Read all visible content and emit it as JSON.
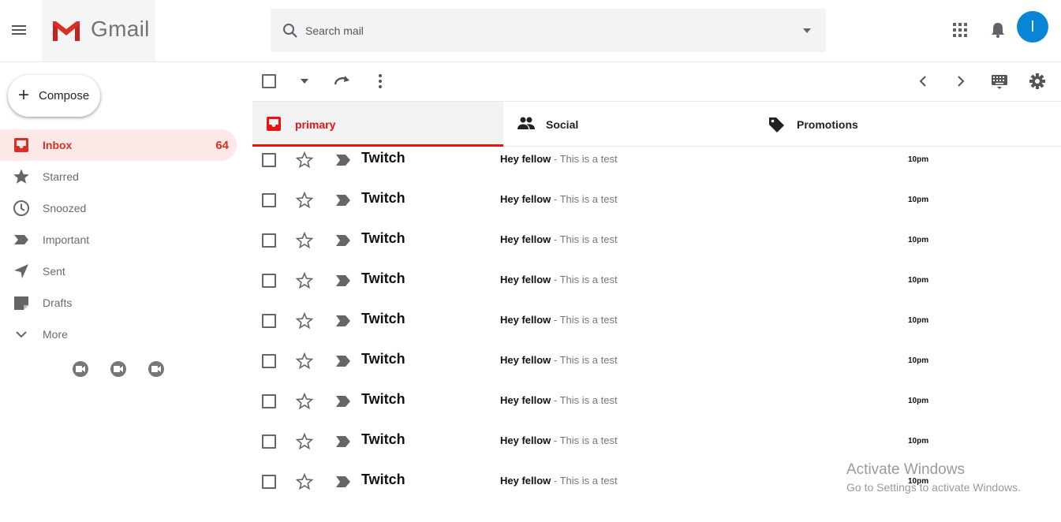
{
  "header": {
    "logo_text": "Gmail",
    "search_placeholder": "Search mail",
    "avatar_initial": "I",
    "avatar_color": "#0a85d6"
  },
  "sidebar": {
    "compose_label": "Compose",
    "items": [
      {
        "label": "Inbox",
        "icon": "inbox-icon",
        "count": "64",
        "active": true
      },
      {
        "label": "Starred",
        "icon": "star-icon"
      },
      {
        "label": "Snoozed",
        "icon": "clock-icon"
      },
      {
        "label": "Important",
        "icon": "important-icon"
      },
      {
        "label": "Sent",
        "icon": "send-icon"
      },
      {
        "label": "Drafts",
        "icon": "drafts-icon"
      },
      {
        "label": "More",
        "icon": "chevron-down-icon"
      }
    ],
    "meet_icons": [
      "video-camera-icon",
      "video-camera-icon",
      "video-camera-icon"
    ]
  },
  "tabs": [
    {
      "label": "primary",
      "icon": "inbox-icon",
      "active": true
    },
    {
      "label": "Social",
      "icon": "people-icon"
    },
    {
      "label": "Promotions",
      "icon": "tag-icon"
    }
  ],
  "accent_color": "#e11111",
  "emails": [
    {
      "sender": "Twitch",
      "subject": "Hey fellow",
      "snippet": " - This is a test",
      "time": "10pm"
    },
    {
      "sender": "Twitch",
      "subject": "Hey fellow",
      "snippet": " - This is a test",
      "time": "10pm"
    },
    {
      "sender": "Twitch",
      "subject": "Hey fellow",
      "snippet": " - This is a test",
      "time": "10pm"
    },
    {
      "sender": "Twitch",
      "subject": "Hey fellow",
      "snippet": " - This is a test",
      "time": "10pm"
    },
    {
      "sender": "Twitch",
      "subject": "Hey fellow",
      "snippet": " - This is a test",
      "time": "10pm"
    },
    {
      "sender": "Twitch",
      "subject": "Hey fellow",
      "snippet": " - This is a test",
      "time": "10pm"
    },
    {
      "sender": "Twitch",
      "subject": "Hey fellow",
      "snippet": " - This is a test",
      "time": "10pm"
    },
    {
      "sender": "Twitch",
      "subject": "Hey fellow",
      "snippet": " - This is a test",
      "time": "10pm"
    },
    {
      "sender": "Twitch",
      "subject": "Hey fellow",
      "snippet": " - This is a test",
      "time": "10pm"
    }
  ],
  "watermark": {
    "line1": "Activate Windows",
    "line2": "Go to Settings to activate Windows."
  }
}
